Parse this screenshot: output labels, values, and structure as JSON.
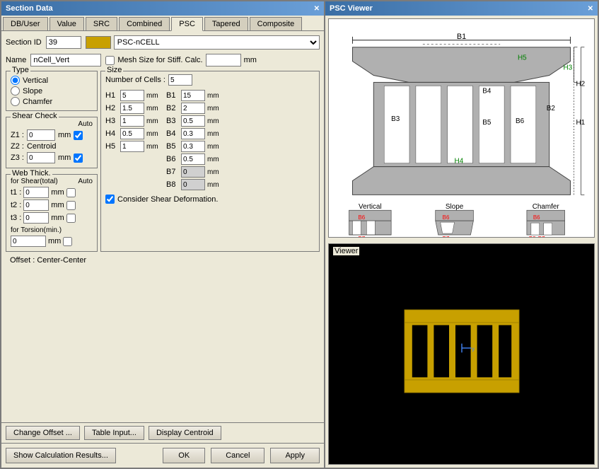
{
  "leftPanel": {
    "title": "Section Data",
    "tabs": [
      "DB/User",
      "Value",
      "SRC",
      "Combined",
      "PSC",
      "Tapered",
      "Composite"
    ],
    "activeTab": "PSC",
    "sectionId": {
      "label": "Section ID",
      "value": "39"
    },
    "pscType": {
      "label": "PSC-nCELL",
      "iconText": "|||"
    },
    "name": {
      "label": "Name",
      "value": "nCell_Vert"
    },
    "meshSize": {
      "label": "Mesh Size for Stiff. Calc.",
      "unit": "mm"
    },
    "type": {
      "groupLabel": "Type",
      "options": [
        "Vertical",
        "Slope",
        "Chamfer"
      ],
      "selected": "Vertical"
    },
    "shearCheck": {
      "groupLabel": "Shear Check",
      "autoLabel": "Auto",
      "z1": {
        "label": "Z1 :",
        "value": "0",
        "unit": "mm",
        "checked": true
      },
      "z2": {
        "label": "Z2 :",
        "value": "Centroid"
      },
      "z3": {
        "label": "Z3 :",
        "value": "0",
        "unit": "mm",
        "checked": true
      }
    },
    "webThick": {
      "groupLabel": "Web Thick.",
      "forShear": "for Shear(total)",
      "autoLabel": "Auto",
      "t1": {
        "label": "t1 :",
        "value": "0",
        "unit": "mm"
      },
      "t2": {
        "label": "t2 :",
        "value": "0",
        "unit": "mm"
      },
      "t3": {
        "label": "t3 :",
        "value": "0",
        "unit": "mm"
      },
      "forTorsion": "for Torsion(min.)",
      "torsionValue": "0",
      "torsionUnit": "mm"
    },
    "size": {
      "groupLabel": "Size",
      "numCells": {
        "label": "Number of Cells :",
        "value": "5"
      },
      "h1": {
        "label": "H1",
        "value": "5",
        "unit": "mm"
      },
      "h2": {
        "label": "H2",
        "value": "1.5",
        "unit": "mm"
      },
      "h3": {
        "label": "H3",
        "value": "1",
        "unit": "mm"
      },
      "h4": {
        "label": "H4",
        "value": "0.5",
        "unit": "mm"
      },
      "h5": {
        "label": "H5",
        "value": "1",
        "unit": "mm"
      },
      "b1": {
        "label": "B1",
        "value": "15",
        "unit": "mm"
      },
      "b2": {
        "label": "B2",
        "value": "2",
        "unit": "mm"
      },
      "b3": {
        "label": "B3",
        "value": "0.5",
        "unit": "mm"
      },
      "b4": {
        "label": "B4",
        "value": "0.3",
        "unit": "mm"
      },
      "b5": {
        "label": "B5",
        "value": "0.3",
        "unit": "mm"
      },
      "b6": {
        "label": "B6",
        "value": "0.5",
        "unit": "mm"
      },
      "b7": {
        "label": "B7",
        "value": "0",
        "unit": "mm"
      },
      "b8": {
        "label": "B8",
        "value": "0",
        "unit": "mm"
      }
    },
    "considerShear": {
      "label": "Consider Shear Deformation.",
      "checked": true
    },
    "offset": {
      "label": "Offset :",
      "value": "Center-Center"
    },
    "buttons": {
      "changeOffset": "Change Offset ...",
      "tableInput": "Table Input...",
      "displayCentroid": "Display Centroid"
    }
  },
  "footer": {
    "showCalc": "Show Calculation Results...",
    "ok": "OK",
    "cancel": "Cancel",
    "apply": "Apply"
  },
  "rightPanel": {
    "title": "PSC Viewer",
    "viewerLabel": "Viewer"
  }
}
